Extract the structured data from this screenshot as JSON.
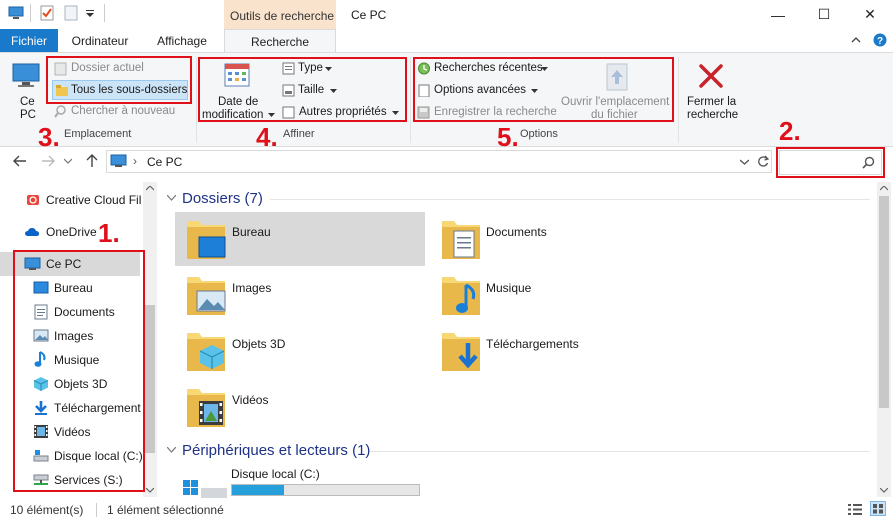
{
  "window": {
    "title": "Ce PC",
    "contextual_tab": "Outils de recherche",
    "controls": {
      "minimize": "—",
      "maximize": "☐",
      "close": "✕"
    }
  },
  "ribbon_tabs": [
    "Fichier",
    "Ordinateur",
    "Affichage",
    "Recherche"
  ],
  "ribbon": {
    "location": {
      "ce_pc_line1": "Ce",
      "ce_pc_line2": "PC",
      "current_folder": "Dossier actuel",
      "all_subfolders": "Tous les sous-dossiers",
      "search_again": "Chercher à nouveau",
      "group_label": "Emplacement"
    },
    "refine": {
      "date_line1": "Date de",
      "date_line2": "modification",
      "type": "Type",
      "size": "Taille",
      "other_props": "Autres propriétés",
      "group_label": "Affiner"
    },
    "options": {
      "recent_searches": "Recherches récentes",
      "advanced": "Options avancées",
      "save_search": "Enregistrer la recherche",
      "open_location_line1": "Ouvrir l'emplacement",
      "open_location_line2": "du fichier",
      "group_label": "Options"
    },
    "close": {
      "line1": "Fermer la",
      "line2": "recherche"
    }
  },
  "annotations": {
    "n1": "1.",
    "n2": "2.",
    "n3": "3.",
    "n4": "4.",
    "n5": "5."
  },
  "address": {
    "path": "Ce PC",
    "separator": "›"
  },
  "nav": {
    "items": [
      {
        "label": "Creative Cloud Fil",
        "level": 0
      },
      {
        "label": "OneDrive",
        "level": 0
      },
      {
        "label": "Ce PC",
        "level": 0,
        "selected": true
      },
      {
        "label": "Bureau",
        "level": 1
      },
      {
        "label": "Documents",
        "level": 1
      },
      {
        "label": "Images",
        "level": 1
      },
      {
        "label": "Musique",
        "level": 1
      },
      {
        "label": "Objets 3D",
        "level": 1
      },
      {
        "label": "Téléchargement",
        "level": 1
      },
      {
        "label": "Vidéos",
        "level": 1
      },
      {
        "label": "Disque local (C:)",
        "level": 1
      },
      {
        "label": "Services (S:)",
        "level": 1
      }
    ]
  },
  "content": {
    "folders_header": "Dossiers (7)",
    "folders": [
      "Bureau",
      "Documents",
      "Images",
      "Musique",
      "Objets 3D",
      "Téléchargements",
      "Vidéos"
    ],
    "devices_header": "Périphériques et lecteurs (1)",
    "drive": {
      "label": "Disque local (C:)",
      "used_fraction": 0.28
    }
  },
  "status": {
    "count": "10 élément(s)",
    "selected": "1 élément sélectionné"
  },
  "colors": {
    "accent": "#1979ca",
    "annotation_red": "#e0101a",
    "context_tab": "#f9e3cc",
    "section_title": "#1e3287"
  }
}
